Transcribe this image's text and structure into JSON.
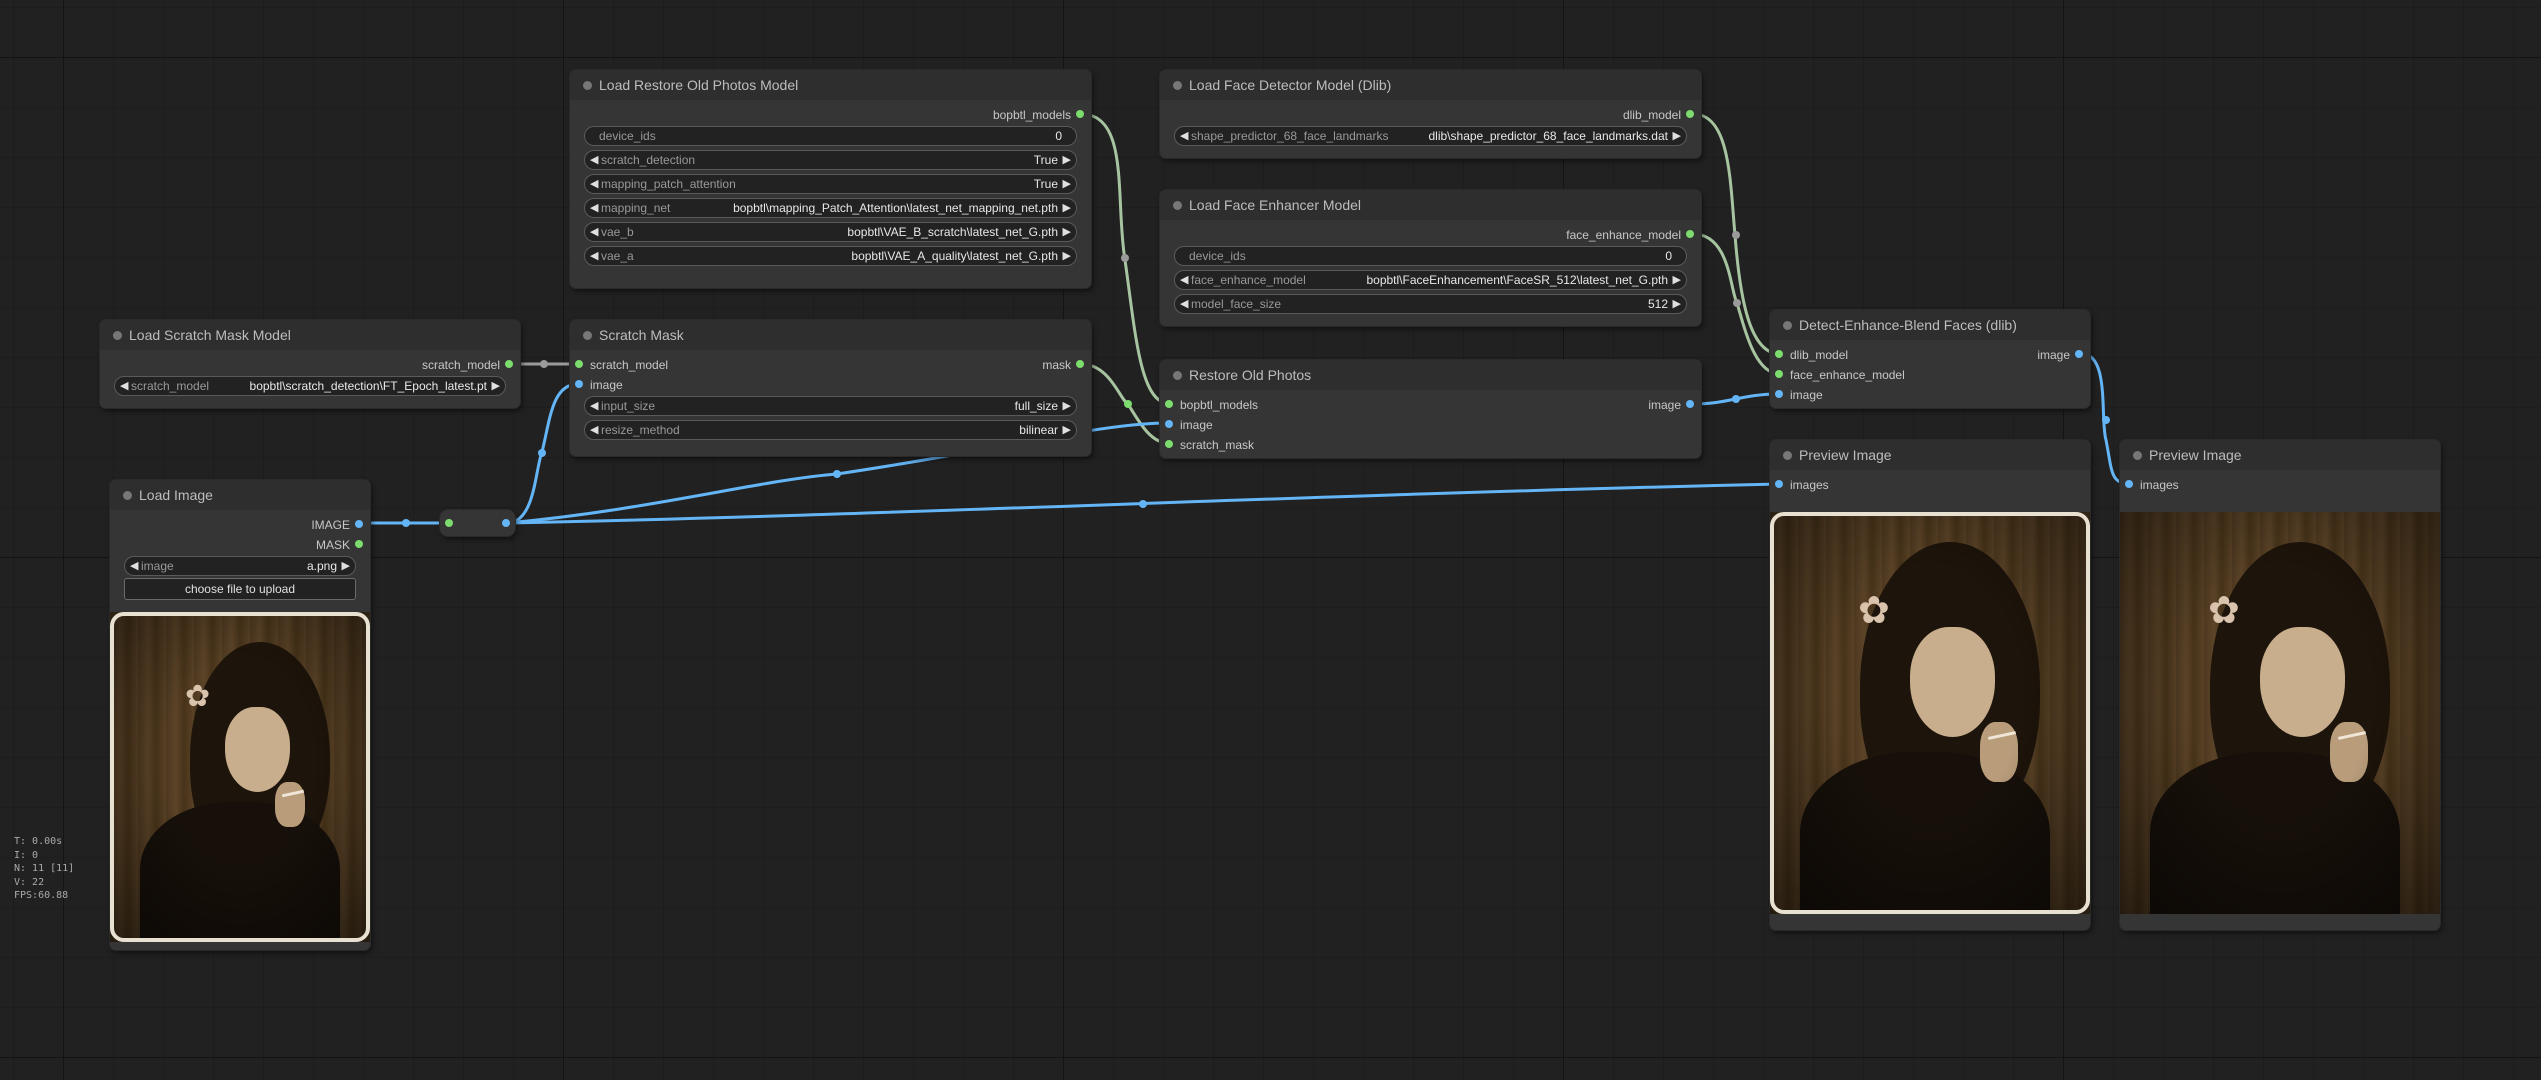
{
  "nodes": {
    "load_restore_model": {
      "title": "Load Restore Old Photos Model",
      "output": "bopbtl_models",
      "widgets": [
        {
          "label": "device_ids",
          "value": "0"
        },
        {
          "label": "scratch_detection",
          "value": "True"
        },
        {
          "label": "mapping_patch_attention",
          "value": "True"
        },
        {
          "label": "mapping_net",
          "value": "bopbtl\\mapping_Patch_Attention\\latest_net_mapping_net.pth"
        },
        {
          "label": "vae_b",
          "value": "bopbtl\\VAE_B_scratch\\latest_net_G.pth"
        },
        {
          "label": "vae_a",
          "value": "bopbtl\\VAE_A_quality\\latest_net_G.pth"
        }
      ]
    },
    "load_face_detector": {
      "title": "Load Face Detector Model (Dlib)",
      "output": "dlib_model",
      "widgets": [
        {
          "label": "shape_predictor_68_face_landmarks",
          "value": "dlib\\shape_predictor_68_face_landmarks.dat"
        }
      ]
    },
    "load_face_enhancer": {
      "title": "Load Face Enhancer Model",
      "output": "face_enhance_model",
      "widgets": [
        {
          "label": "device_ids",
          "value": "0"
        },
        {
          "label": "face_enhance_model",
          "value": "bopbtl\\FaceEnhancement\\FaceSR_512\\latest_net_G.pth"
        },
        {
          "label": "model_face_size",
          "value": "512"
        }
      ]
    },
    "load_scratch_mask": {
      "title": "Load Scratch Mask Model",
      "output": "scratch_model",
      "widgets": [
        {
          "label": "scratch_model",
          "value": "bopbtl\\scratch_detection\\FT_Epoch_latest.pt"
        }
      ]
    },
    "scratch_mask": {
      "title": "Scratch Mask",
      "inputs": [
        "scratch_model",
        "image"
      ],
      "output": "mask",
      "widgets": [
        {
          "label": "input_size",
          "value": "full_size"
        },
        {
          "label": "resize_method",
          "value": "bilinear"
        }
      ]
    },
    "restore_old_photos": {
      "title": "Restore Old Photos",
      "inputs": [
        "bopbtl_models",
        "image",
        "scratch_mask"
      ],
      "output": "image"
    },
    "detect_enhance_blend": {
      "title": "Detect-Enhance-Blend Faces (dlib)",
      "inputs": [
        "dlib_model",
        "face_enhance_model",
        "image"
      ],
      "output": "image"
    },
    "load_image": {
      "title": "Load Image",
      "outputs": [
        "IMAGE",
        "MASK"
      ],
      "widget": {
        "label": "image",
        "value": "a.png"
      },
      "upload_label": "choose file to upload"
    },
    "preview_1": {
      "title": "Preview Image",
      "input": "images"
    },
    "preview_2": {
      "title": "Preview Image",
      "input": "images"
    }
  },
  "stats": [
    "T: 0.00s",
    "I: 0",
    "N: 11 [11]",
    "V: 22",
    "FPS:60.88"
  ],
  "colors": {
    "background": "#212121",
    "node_body": "#353535",
    "node_title": "#2e2e2e",
    "link_image": "#64b5f6",
    "link_model": "#a7c4a0",
    "slot_model": "#7ddc6e",
    "slot_image": "#64b5f6"
  }
}
